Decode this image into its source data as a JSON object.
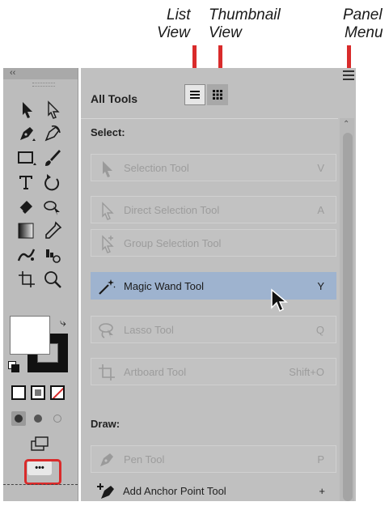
{
  "callouts": {
    "list_view": [
      "List",
      "View"
    ],
    "thumbnail_view": [
      "Thumbnail",
      "View"
    ],
    "panel_menu": [
      "Panel",
      "Menu"
    ]
  },
  "toolbar": {
    "collapse_glyph": "‹‹",
    "more_button": "•••"
  },
  "panel": {
    "title": "All Tools",
    "sections": {
      "select": "Select:",
      "draw": "Draw:"
    },
    "rows": [
      {
        "label": "Selection Tool",
        "shortcut": "V",
        "state": "dim"
      },
      {
        "label": "Direct Selection Tool",
        "shortcut": "A",
        "state": "dim"
      },
      {
        "label": "Group Selection Tool",
        "shortcut": "",
        "state": "dim"
      },
      {
        "label": "Magic Wand Tool",
        "shortcut": "Y",
        "state": "selected"
      },
      {
        "label": "Lasso Tool",
        "shortcut": "Q",
        "state": "dim"
      },
      {
        "label": "Artboard Tool",
        "shortcut": "Shift+O",
        "state": "dim"
      },
      {
        "label": "Pen Tool",
        "shortcut": "P",
        "state": "dim"
      },
      {
        "label": "Add Anchor Point Tool",
        "shortcut": "+",
        "state": "normal"
      }
    ]
  },
  "colors": {
    "callout_red": "#d92b2b",
    "selected_row": "#9eb3cf",
    "panel_bg": "#c0c0c0"
  }
}
